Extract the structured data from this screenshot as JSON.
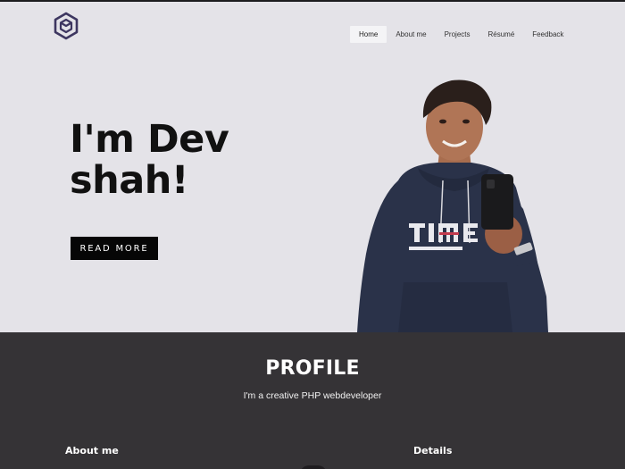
{
  "nav": {
    "items": [
      {
        "label": "Home",
        "active": true
      },
      {
        "label": "About me",
        "active": false
      },
      {
        "label": "Projects",
        "active": false
      },
      {
        "label": "Résumé",
        "active": false
      },
      {
        "label": "Feedback",
        "active": false
      }
    ]
  },
  "hero": {
    "title_line1": "I'm Dev",
    "title_line2": "shah!",
    "button_label": "READ MORE"
  },
  "profile": {
    "title": "PROFILE",
    "subtitle": "I'm a creative PHP webdeveloper",
    "about_heading": "About me",
    "details_heading": "Details"
  },
  "colors": {
    "hero_bg": "#e4e3e8",
    "profile_bg": "#353336",
    "accent_dark": "#060606",
    "logo": "#3d3660"
  },
  "icons": {
    "logo": "hexagon-cube-logo-icon"
  }
}
